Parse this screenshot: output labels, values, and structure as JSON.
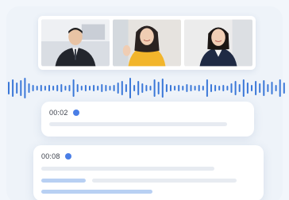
{
  "video_call": {
    "participants": [
      {
        "name": "participant-man-suit"
      },
      {
        "name": "participant-woman-yellow"
      },
      {
        "name": "participant-woman-navy"
      }
    ]
  },
  "transcript": {
    "entries": [
      {
        "timestamp": "00:02",
        "line_count": 1,
        "highlighted": false
      },
      {
        "timestamp": "00:08",
        "line_count": 3,
        "highlighted": true
      }
    ]
  },
  "colors": {
    "accent": "#4a7ee6",
    "waveform": "#3b78d8",
    "highlight": "#b8d0f3",
    "placeholder": "#e7ebf1"
  }
}
